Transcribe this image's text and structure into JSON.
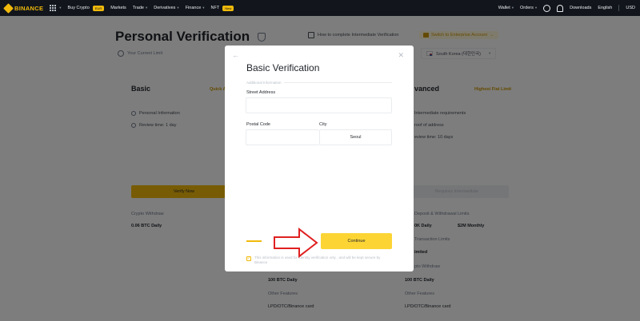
{
  "nav": {
    "logo_text": "BINANCE",
    "items": [
      {
        "label": "Buy Crypto",
        "badge": "EUR"
      },
      {
        "label": "Markets"
      },
      {
        "label": "Trade"
      },
      {
        "label": "Derivatives"
      },
      {
        "label": "Finance"
      },
      {
        "label": "NFT",
        "badge": "New"
      }
    ],
    "right": {
      "wallet": "Wallet",
      "orders": "Orders",
      "downloads": "Downloads",
      "language": "English",
      "currency": "USD"
    }
  },
  "page": {
    "title": "Personal Verification",
    "help_link": "How to complete Intermediate Verification",
    "enterprise_link": "Switch to Enterprise Account",
    "limit_label": "Your Current Limit",
    "country": "South Korea (대한민국)"
  },
  "basic_card": {
    "heading": "Basic",
    "side_link": "Quick A",
    "features": [
      "Personal Information",
      "Review time: 1 day"
    ],
    "button": "Verify Now",
    "withdraw_label": "Crypto Withdraw",
    "withdraw_value": "0.06 BTC Daily"
  },
  "middle_col": {
    "withdraw_value": "100 BTC Daily",
    "other_label": "Other Features",
    "other_value": "LPD/OTC/Binance card"
  },
  "advanced_card": {
    "heading": "vanced",
    "side_link": "Highest Fiat Limit",
    "features": [
      "Intermediate requirements",
      "roof of address",
      "eview time: 10 days"
    ],
    "button": "Requires Intermediate",
    "deposit_label": "Deposit & Withdrawal Limits",
    "deposit_value": "0K Daily",
    "deposit_monthly": "$2M Monthly",
    "transaction_label": "Transaction Limits",
    "transaction_value": "imited",
    "withdraw_label": "pto Withdraw",
    "withdraw_value": "100 BTC Daily",
    "other_label": "Other Features",
    "other_value": "LPD/OTC/Binance card"
  },
  "modal": {
    "title": "Basic Verification",
    "section": "Additional Information",
    "street_label": "Street Address",
    "street_value": "",
    "postal_label": "Postal Code",
    "postal_value": "",
    "city_label": "City",
    "city_value": "Seoul",
    "continue_label": "Continue",
    "check_mark": "✓",
    "disclaimer": "This information is used for identity verification only , and will be kept secure by Binance"
  },
  "colors": {
    "brand": "#f0b90b",
    "button": "#fcd535",
    "annotation": "#e02020"
  }
}
